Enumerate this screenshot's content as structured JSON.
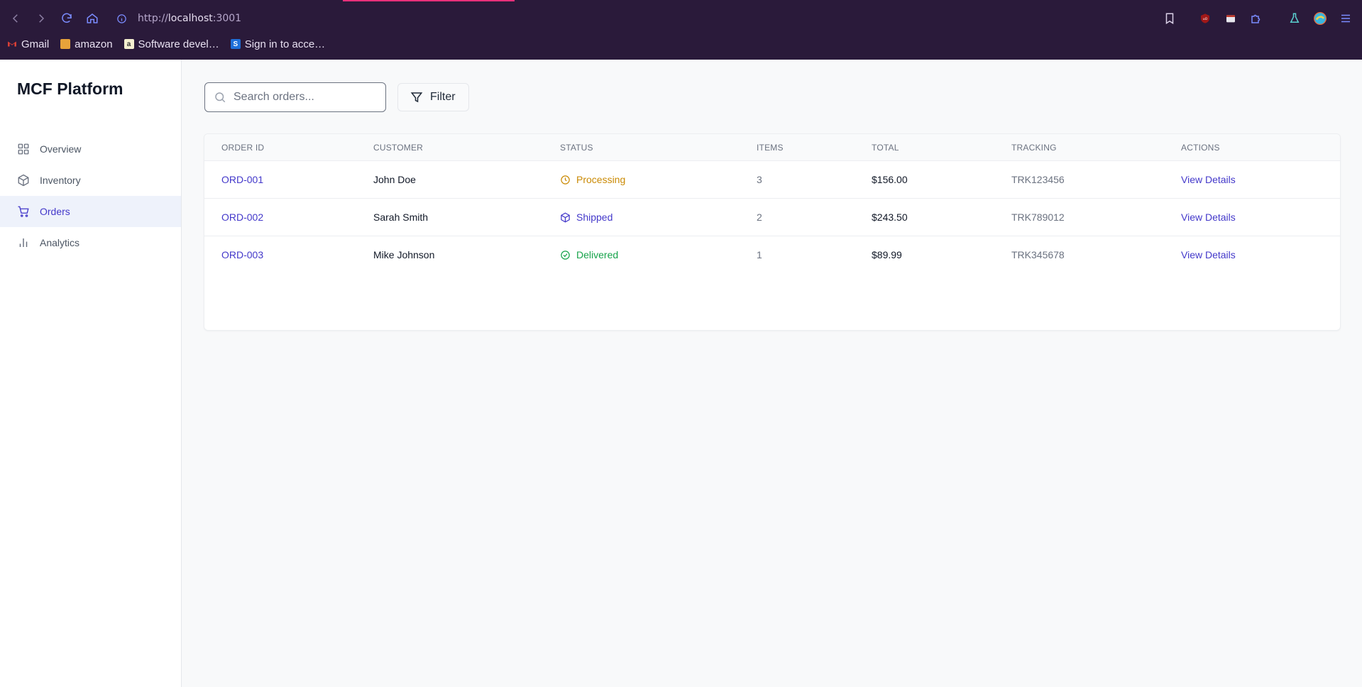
{
  "browser": {
    "url_scheme": "http://",
    "url_host": "localhost",
    "url_port": ":3001",
    "bookmarks": [
      {
        "label": "Gmail",
        "icon": "gmail-icon",
        "color": "#ea4335"
      },
      {
        "label": "amazon",
        "icon": "amazon-icon",
        "color": "#f0a030"
      },
      {
        "label": "Software devel…",
        "icon": "bookmark-a-icon",
        "color": "#f5f0d0"
      },
      {
        "label": "Sign in to acce…",
        "icon": "bookmark-s-icon",
        "color": "#1e6fd9"
      }
    ]
  },
  "sidebar": {
    "brand": "MCF Platform",
    "items": [
      {
        "label": "Overview",
        "icon": "grid-icon",
        "active": false
      },
      {
        "label": "Inventory",
        "icon": "box-icon",
        "active": false
      },
      {
        "label": "Orders",
        "icon": "cart-icon",
        "active": true
      },
      {
        "label": "Analytics",
        "icon": "bar-chart-icon",
        "active": false
      }
    ]
  },
  "toolbar": {
    "search_placeholder": "Search orders...",
    "filter_label": "Filter"
  },
  "table": {
    "headers": [
      "ORDER ID",
      "CUSTOMER",
      "STATUS",
      "ITEMS",
      "TOTAL",
      "TRACKING",
      "ACTIONS"
    ],
    "rows": [
      {
        "order_id": "ORD-001",
        "customer": "John Doe",
        "status": "Processing",
        "status_icon": "clock-icon",
        "status_color": "#ca8a04",
        "items": "3",
        "total": "$156.00",
        "tracking": "TRK123456",
        "action": "View Details"
      },
      {
        "order_id": "ORD-002",
        "customer": "Sarah Smith",
        "status": "Shipped",
        "status_icon": "package-icon",
        "status_color": "#4338ca",
        "items": "2",
        "total": "$243.50",
        "tracking": "TRK789012",
        "action": "View Details"
      },
      {
        "order_id": "ORD-003",
        "customer": "Mike Johnson",
        "status": "Delivered",
        "status_icon": "check-circle-icon",
        "status_color": "#16a34a",
        "items": "1",
        "total": "$89.99",
        "tracking": "TRK345678",
        "action": "View Details"
      }
    ]
  },
  "colors": {
    "accent": "#4338ca",
    "browser_bg": "#2a1a3a"
  }
}
